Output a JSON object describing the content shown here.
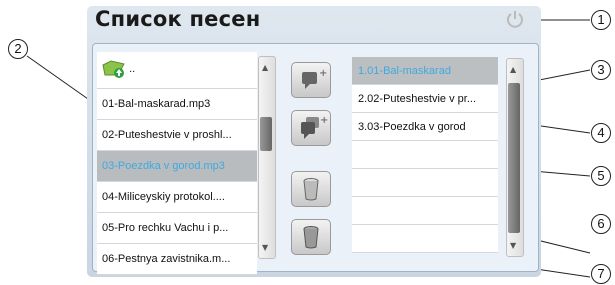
{
  "header": {
    "title": "Список песен"
  },
  "left_list": {
    "up_label": "..",
    "items": [
      "01-Bal-maskarad.mp3",
      "02-Puteshestvie v proshl...",
      "03-Poezdka v gorod.mp3",
      "04-Miliceyskiy protokol....",
      "05-Pro rechku Vachu i p...",
      "06-Pestnya zavistnika.m..."
    ],
    "selected_index": 2
  },
  "right_list": {
    "items": [
      "1.01-Bal-maskarad",
      "2.02-Puteshestvie v pr...",
      "3.03-Poezdka v gorod",
      "",
      "",
      "",
      "",
      ""
    ],
    "selected_index": 0
  },
  "buttons": {
    "add_one": "add-item-icon",
    "add_all": "add-all-icon",
    "delete_one": "trash-icon",
    "delete_all": "trash-full-icon"
  },
  "callouts": [
    "1",
    "2",
    "3",
    "4",
    "5",
    "6",
    "7"
  ],
  "colors": {
    "accent": "#3fa9e0",
    "selection": "#b9bcbe",
    "panel": "#eaf1f8"
  }
}
